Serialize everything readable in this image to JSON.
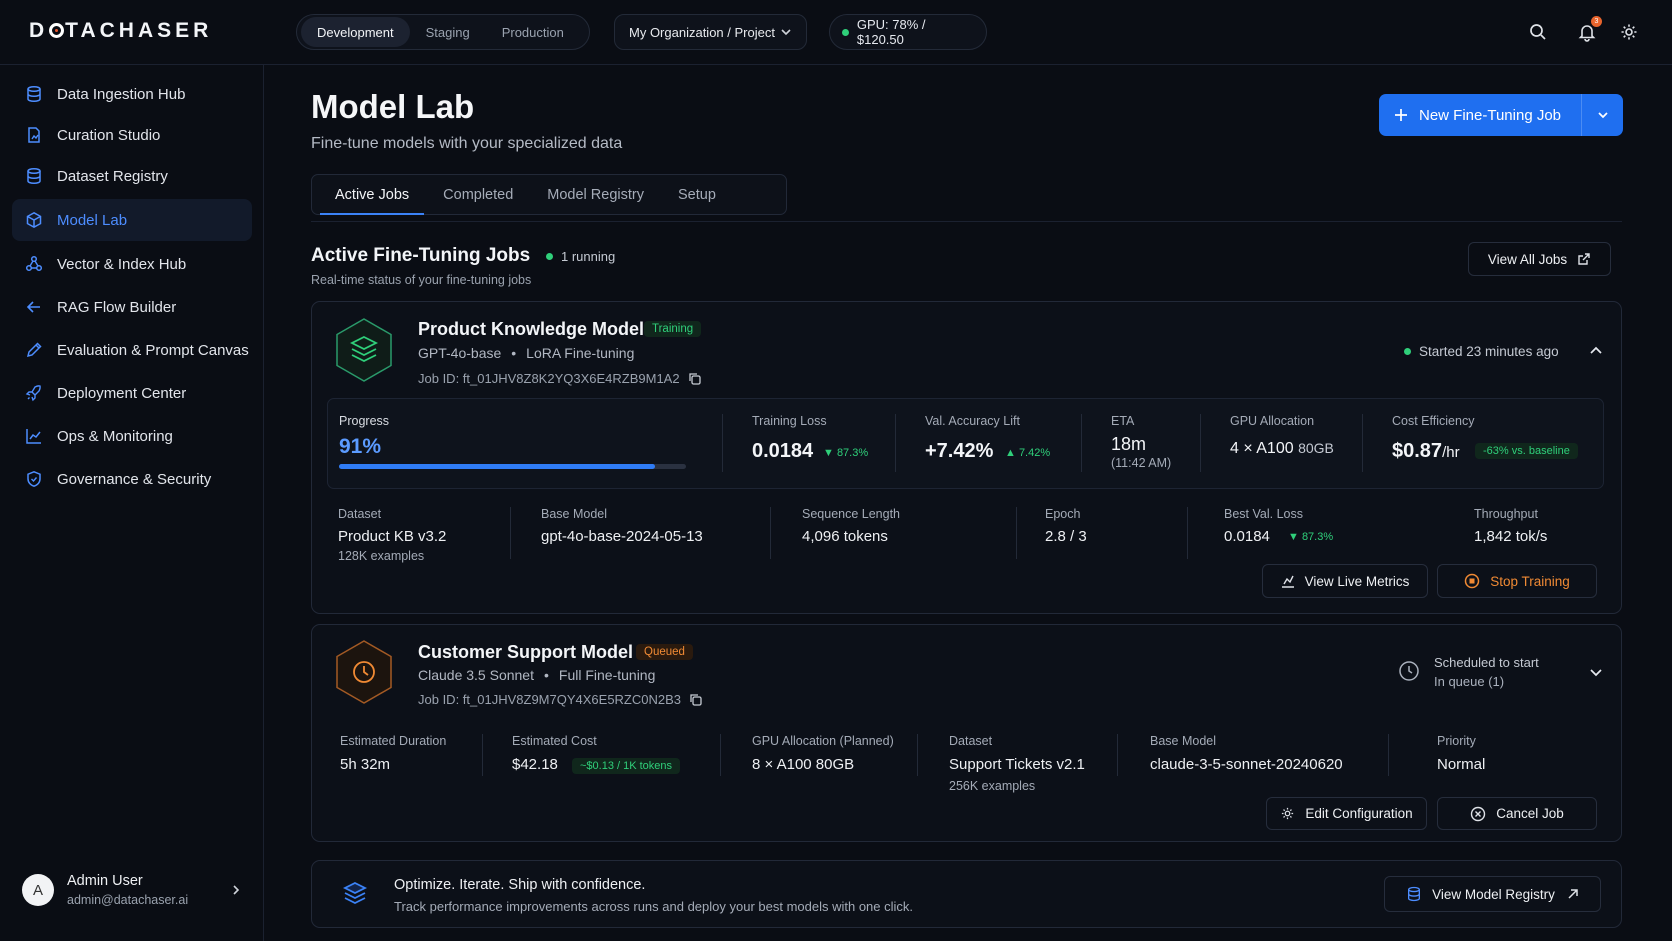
{
  "app": {
    "logo": "DATACHASER"
  },
  "topbar": {
    "environments": [
      "Development",
      "Staging",
      "Production"
    ],
    "active_environment": "Development",
    "org_selector": "My Organization / Project",
    "gpu_status": "GPU: 78% / $120.50",
    "notification_count": "3",
    "icons": [
      "search-icon",
      "bell-icon",
      "gear-icon"
    ]
  },
  "sidebar": {
    "items": [
      {
        "label": "Data Ingestion Hub",
        "icon": "database-icon"
      },
      {
        "label": "Curation Studio",
        "icon": "curation-icon"
      },
      {
        "label": "Dataset Registry",
        "icon": "database-icon"
      },
      {
        "label": "Model Lab",
        "icon": "cube-icon"
      },
      {
        "label": "Vector & Index Hub",
        "icon": "nodes-icon"
      },
      {
        "label": "RAG Flow Builder",
        "icon": "arrow-left-icon"
      },
      {
        "label": "Evaluation & Prompt Canvas",
        "icon": "pencil-icon"
      },
      {
        "label": "Deployment Center",
        "icon": "rocket-icon"
      },
      {
        "label": "Ops & Monitoring",
        "icon": "chart-icon"
      },
      {
        "label": "Governance & Security",
        "icon": "shield-icon"
      }
    ],
    "active": "Model Lab",
    "user": {
      "initial": "A",
      "name": "Admin User",
      "email": "admin@datachaser.ai"
    }
  },
  "page": {
    "title": "Model Lab",
    "subtitle": "Fine-tune models with your specialized data",
    "new_job_label": "New Fine-Tuning Job",
    "tabs": [
      "Active Jobs",
      "Completed",
      "Model Registry",
      "Setup"
    ],
    "active_tab": "Active Jobs"
  },
  "section": {
    "title": "Active Fine-Tuning Jobs",
    "running": "1 running",
    "subtitle": "Real-time status of your fine-tuning jobs",
    "view_all": "View All Jobs"
  },
  "job1": {
    "name": "Product Knowledge Model",
    "status": "Training",
    "base": "GPT-4o-base",
    "method": "LoRA Fine-tuning",
    "job_id": "Job ID: ft_01JHV8Z8K2YQ3X6E4RZB9M1A2",
    "started": "Started 23 minutes ago",
    "progress_label": "Progress",
    "progress_value": "91%",
    "progress_fraction": 0.91,
    "training_loss_label": "Training Loss",
    "training_loss": "0.0184",
    "training_loss_delta": "▼ 87.3%",
    "val_acc_label": "Val. Accuracy Lift",
    "val_acc": "+7.42%",
    "val_acc_delta": "▲ 7.42%",
    "eta_label": "ETA",
    "eta": "18m",
    "eta_time": "(11:42 AM)",
    "gpu_label": "GPU Allocation",
    "gpu_count": "4 × A100",
    "gpu_mem": "80GB",
    "cost_label": "Cost Efficiency",
    "cost": "$0.87",
    "cost_unit": "/hr",
    "cost_delta": "-63% vs. baseline",
    "dataset_label": "Dataset",
    "dataset": "Product KB v3.2",
    "dataset_examples": "128K examples",
    "base_model_label": "Base Model",
    "base_model": "gpt-4o-base-2024-05-13",
    "seq_label": "Sequence Length",
    "seq": "4,096 tokens",
    "epoch_label": "Epoch",
    "epoch": "2.8 / 3",
    "best_loss_label": "Best Val. Loss",
    "best_loss": "0.0184",
    "best_loss_delta": "▼ 87.3%",
    "throughput_label": "Throughput",
    "throughput": "1,842 tok/s",
    "view_metrics": "View Live Metrics",
    "stop": "Stop Training"
  },
  "job2": {
    "name": "Customer Support Model",
    "status": "Queued",
    "base": "Claude 3.5 Sonnet",
    "method": "Full Fine-tuning",
    "job_id": "Job ID: ft_01JHV8Z9M7QY4X6E5RZC0N2B3",
    "scheduled": "Scheduled to start",
    "queue": "In queue (1)",
    "duration_label": "Estimated Duration",
    "duration": "5h 32m",
    "cost_label": "Estimated Cost",
    "cost": "$42.18",
    "cost_rate": "~$0.13 / 1K tokens",
    "gpu_label": "GPU Allocation (Planned)",
    "gpu": "8 × A100 80GB",
    "dataset_label": "Dataset",
    "dataset": "Support Tickets v2.1",
    "dataset_examples": "256K examples",
    "base_model_label": "Base Model",
    "base_model": "claude-3-5-sonnet-20240620",
    "priority_label": "Priority",
    "priority": "Normal",
    "edit": "Edit Configuration",
    "cancel": "Cancel Job"
  },
  "footer_card": {
    "title": "Optimize. Iterate. Ship with confidence.",
    "subtitle": "Track performance improvements across runs and deploy your best models with one click.",
    "button": "View Model Registry"
  },
  "colors": {
    "accent": "#1f6ff0",
    "success": "#2fcf7a",
    "warning": "#f08a34",
    "background": "#0a0d14"
  }
}
